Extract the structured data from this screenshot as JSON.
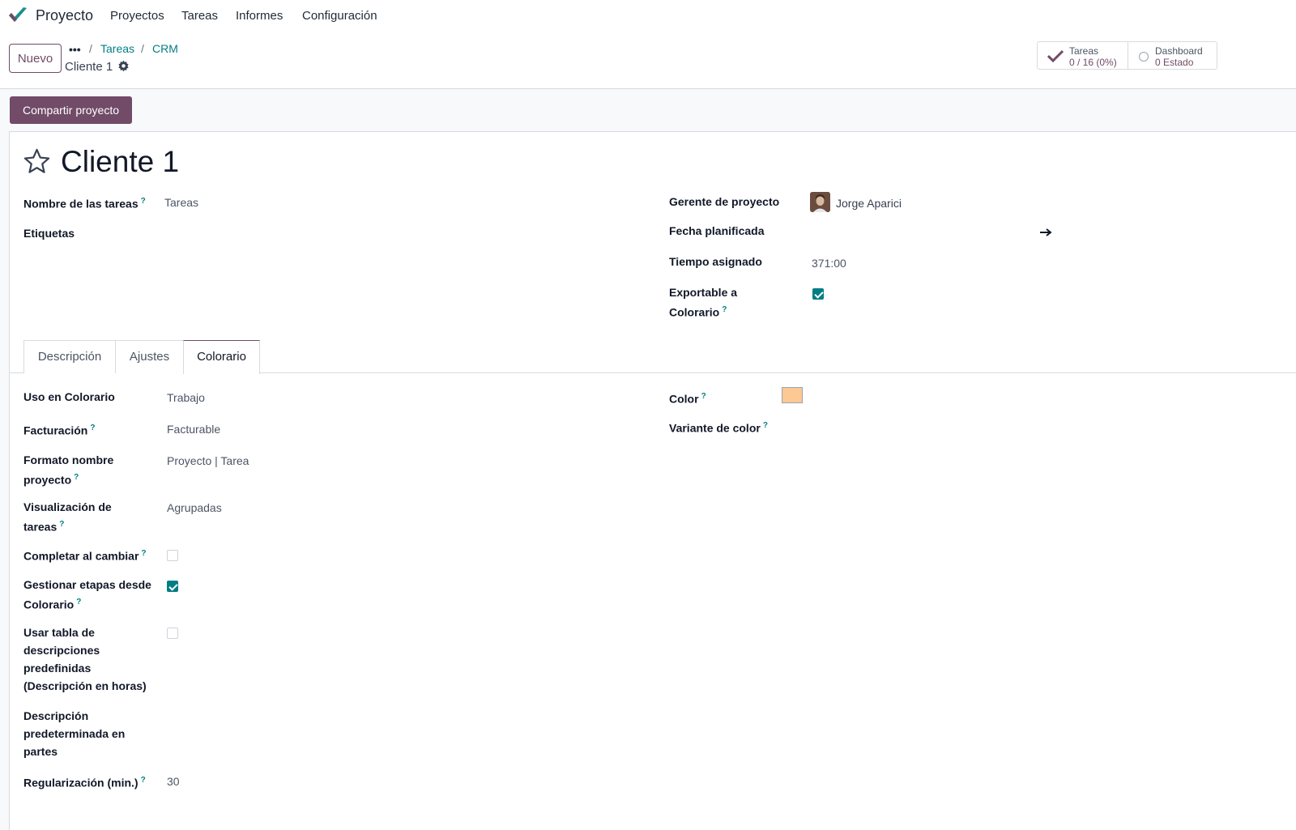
{
  "nav": {
    "app_name": "Proyecto",
    "menu": [
      "Proyectos",
      "Tareas",
      "Informes",
      "Configuración"
    ]
  },
  "control": {
    "new_label": "Nuevo",
    "breadcrumb_dots": "•••",
    "breadcrumb": [
      "Tareas",
      "CRM"
    ],
    "current": "Cliente 1",
    "smart_buttons": [
      {
        "label": "Tareas",
        "value": "0 / 16 (0%)",
        "icon": "check-icon"
      },
      {
        "label": "Dashboard",
        "value": "0 Estado",
        "icon": "circle-icon"
      }
    ]
  },
  "status_bar": {
    "share_label": "Compartir proyecto"
  },
  "form": {
    "title": "Cliente 1",
    "left": {
      "task_name_label": "Nombre de las tareas",
      "task_name_value": "Tareas",
      "tags_label": "Etiquetas"
    },
    "right": {
      "manager_label": "Gerente de proyecto",
      "manager_value": "Jorge Aparici",
      "date_label": "Fecha planificada",
      "time_label": "Tiempo asignado",
      "time_value": "371:00",
      "exportable_label_1": "Exportable a",
      "exportable_label_2": "Colorario",
      "exportable_checked": true
    },
    "tabs": [
      {
        "label": "Descripción",
        "active": false
      },
      {
        "label": "Ajustes",
        "active": false
      },
      {
        "label": "Colorario",
        "active": true
      }
    ],
    "colorario": {
      "uso_label": "Uso en Colorario",
      "uso_value": "Trabajo",
      "facturacion_label": "Facturación",
      "facturacion_value": "Facturable",
      "formato_label_1": "Formato nombre",
      "formato_label_2": "proyecto",
      "formato_value": "Proyecto | Tarea",
      "visualizacion_label_1": "Visualización de",
      "visualizacion_label_2": "tareas",
      "visualizacion_value": "Agrupadas",
      "completar_label": "Completar al cambiar",
      "completar_checked": false,
      "gestionar_label_1": "Gestionar etapas desde",
      "gestionar_label_2": "Colorario",
      "gestionar_checked": true,
      "usar_tabla_label_1": "Usar tabla de",
      "usar_tabla_label_2": "descripciones",
      "usar_tabla_label_3": "predefinidas",
      "usar_tabla_label_4": "(Descripción en horas)",
      "usar_tabla_checked": false,
      "descripcion_label_1": "Descripción",
      "descripcion_label_2": "predeterminada en",
      "descripcion_label_3": "partes",
      "regularizacion_label": "Regularización (min.)",
      "regularizacion_value": "30",
      "color_label": "Color",
      "color_value": "#fcc894",
      "variante_label": "Variante de color"
    },
    "help_mark": "?"
  }
}
